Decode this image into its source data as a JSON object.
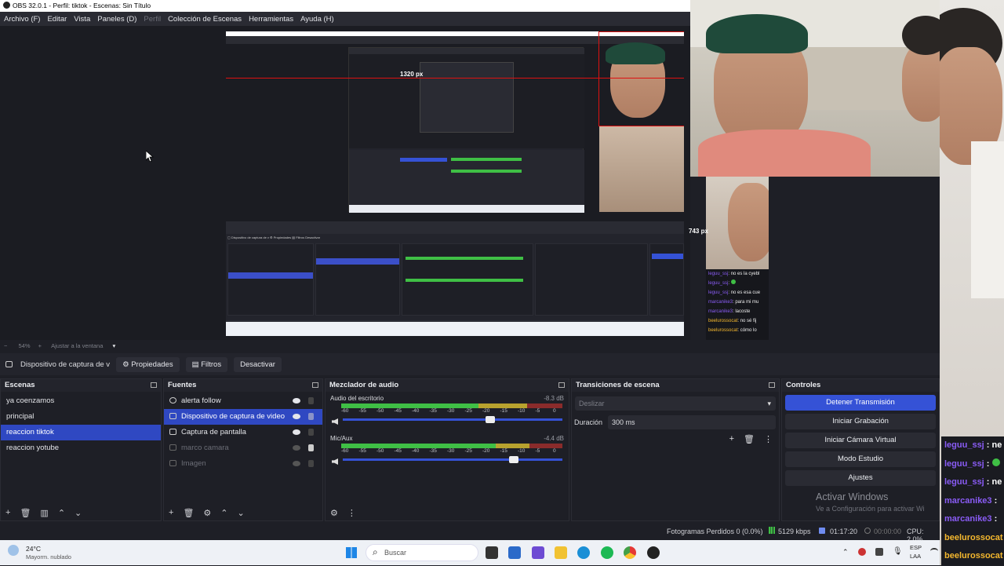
{
  "window": {
    "title": "OBS 32.0.1 - Perfil: tiktok - Escenas: Sin Título"
  },
  "menu": [
    {
      "label": "Archivo (F)",
      "enabled": true
    },
    {
      "label": "Editar",
      "enabled": true
    },
    {
      "label": "Vista",
      "enabled": true
    },
    {
      "label": "Paneles (D)",
      "enabled": true
    },
    {
      "label": "Perfil",
      "enabled": false
    },
    {
      "label": "Colección de Escenas",
      "enabled": true
    },
    {
      "label": "Herramientas",
      "enabled": true
    },
    {
      "label": "Ayuda (H)",
      "enabled": true
    }
  ],
  "preview": {
    "width_label": "1320 px",
    "height_label": "743 px",
    "zoom": "54%",
    "fit_label": "Ajustar a la ventana"
  },
  "source_toolbar": {
    "current_source": "Dispositivo de captura de v",
    "properties": "Propiedades",
    "filters": "Filtros",
    "deactivate": "Desactivar"
  },
  "scenes": {
    "title": "Escenas",
    "items": [
      "ya coenzamos",
      "principal",
      "reaccion tiktok",
      "reaccion yotube"
    ],
    "selected_index": 2
  },
  "sources": {
    "title": "Fuentes",
    "items": [
      {
        "name": "alerta follow",
        "visible": true,
        "locked": false
      },
      {
        "name": "Dispositivo de captura de video",
        "visible": true,
        "locked": false
      },
      {
        "name": "Captura de pantalla",
        "visible": true,
        "locked": false
      },
      {
        "name": "marco camara",
        "visible": false,
        "locked": true
      },
      {
        "name": "Imagen",
        "visible": false,
        "locked": false
      }
    ],
    "selected_index": 1
  },
  "mixer": {
    "title": "Mezclador de audio",
    "channels": [
      {
        "name": "Audio del escritorio",
        "db": "-8.3 dB",
        "volume": 0.68
      },
      {
        "name": "Mic/Aux",
        "db": "-4.4 dB",
        "volume": 0.79
      }
    ],
    "ticks": [
      "-60",
      "-55",
      "-50",
      "-45",
      "-40",
      "-35",
      "-30",
      "-25",
      "-20",
      "-15",
      "-10",
      "-5",
      "0"
    ]
  },
  "transitions": {
    "title": "Transiciones de escena",
    "type": "Deslizar",
    "duration_label": "Duración",
    "duration_value": "300 ms"
  },
  "controls": {
    "title": "Controles",
    "buttons": [
      "Detener Transmisión",
      "Iniciar Grabación",
      "Iniciar Cámara Virtual",
      "Modo Estudio",
      "Ajustes"
    ]
  },
  "watermark": {
    "line1": "Activar Windows",
    "line2": "Ve a Configuración para activar Wi"
  },
  "status": {
    "dropped": "Fotogramas Perdidos 0 (0.0%)",
    "bitrate": "5129 kbps",
    "stream_time": "01:17:20",
    "rec_time": "00:00:00",
    "cpu": "CPU: 2.0%"
  },
  "taskbar": {
    "weather_temp": "24°C",
    "weather_desc": "Mayorm. nublado",
    "search": "Buscar",
    "lang1": "ESP",
    "lang2": "LAA"
  },
  "chat": [
    {
      "user": "leguu_ssj",
      "msg": "ne",
      "color": "purple"
    },
    {
      "user": "leguu_ssj",
      "msg": "",
      "color": "purple"
    },
    {
      "user": "leguu_ssj",
      "msg": "ne",
      "color": "purple"
    },
    {
      "user": "marcanike3",
      "msg": "",
      "color": "purple"
    },
    {
      "user": "marcanike3",
      "msg": "",
      "color": "purple"
    },
    {
      "user": "beelurossocat",
      "msg": "",
      "color": "gold"
    },
    {
      "user": "beelurossocat",
      "msg": "",
      "color": "gold"
    }
  ],
  "mini_chat": [
    {
      "user": "leguu_ssj",
      "msg": ": no es la cyebl",
      "color": "purple"
    },
    {
      "user": "leguu_ssj",
      "msg": ":",
      "color": "purple"
    },
    {
      "user": "leguu_ssj",
      "msg": ": no es esa cue",
      "color": "purple"
    },
    {
      "user": "marcanike3",
      "msg": ": para mi mu",
      "color": "purple"
    },
    {
      "user": "marcanike3",
      "msg": ": lacoste",
      "color": "purple"
    },
    {
      "user": "beelurossocat",
      "msg": ": no sé fij",
      "color": "gold"
    },
    {
      "user": "beelurossocat",
      "msg": ": cómo lo",
      "color": "gold"
    }
  ],
  "colors": {
    "accent": "#3552d6",
    "selection": "#2f48c2",
    "chat_user": "#8a5cf6",
    "chat_gold": "#f5b82e"
  }
}
